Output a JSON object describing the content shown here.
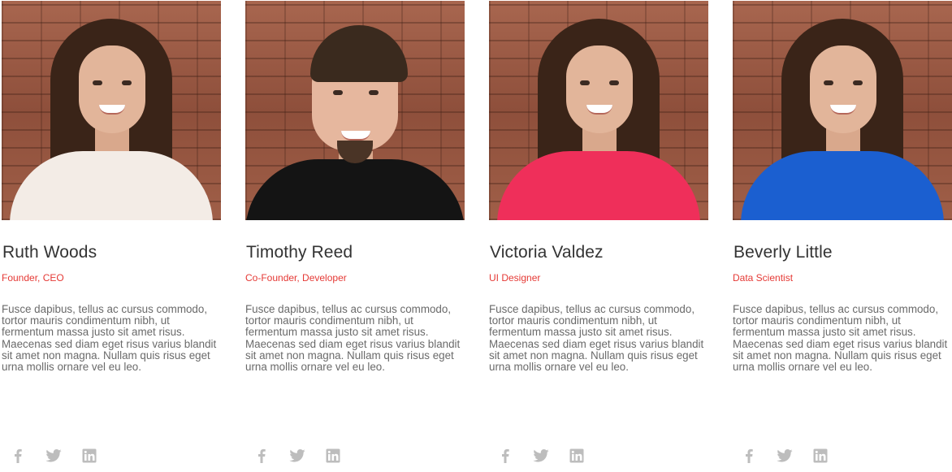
{
  "team": [
    {
      "name": "Ruth Woods",
      "role": "Founder, CEO",
      "bio": "Fusce dapibus, tellus ac cursus commodo, tortor mauris condimentum nibh, ut fermentum massa justo sit amet risus. Maecenas sed diam eget risus varius blandit sit amet non magna. Nullam quis risus eget urna mollis ornare vel eu leo.",
      "shirt_color": "#f3ece6",
      "photo_alt": "Ruth Woods"
    },
    {
      "name": "Timothy Reed",
      "role": "Co-Founder, Developer",
      "bio": "Fusce dapibus, tellus ac cursus commodo, tortor mauris condimentum nibh, ut fermentum massa justo sit amet risus. Maecenas sed diam eget risus varius blandit sit amet non magna. Nullam quis risus eget urna mollis ornare vel eu leo.",
      "shirt_color": "#141414",
      "photo_alt": "Timothy Reed"
    },
    {
      "name": "Victoria Valdez",
      "role": "UI Designer",
      "bio": "Fusce dapibus, tellus ac cursus commodo, tortor mauris condimentum nibh, ut fermentum massa justo sit amet risus. Maecenas sed diam eget risus varius blandit sit amet non magna. Nullam quis risus eget urna mollis ornare vel eu leo.",
      "shirt_color": "#ef2f5a",
      "photo_alt": "Victoria Valdez"
    },
    {
      "name": "Beverly Little",
      "role": "Data Scientist",
      "bio": "Fusce dapibus, tellus ac cursus commodo, tortor mauris condimentum nibh, ut fermentum massa justo sit amet risus. Maecenas sed diam eget risus varius blandit sit amet non magna. Nullam quis risus eget urna mollis ornare vel eu leo.",
      "shirt_color": "#1b5fd0",
      "photo_alt": "Beverly Little"
    }
  ],
  "social_icons": [
    "facebook-icon",
    "twitter-icon",
    "linkedin-icon"
  ],
  "colors": {
    "role_accent": "#e53935",
    "name_text": "#333333",
    "bio_text": "#6a6a6a",
    "social_icon": "#bdbdbd"
  }
}
